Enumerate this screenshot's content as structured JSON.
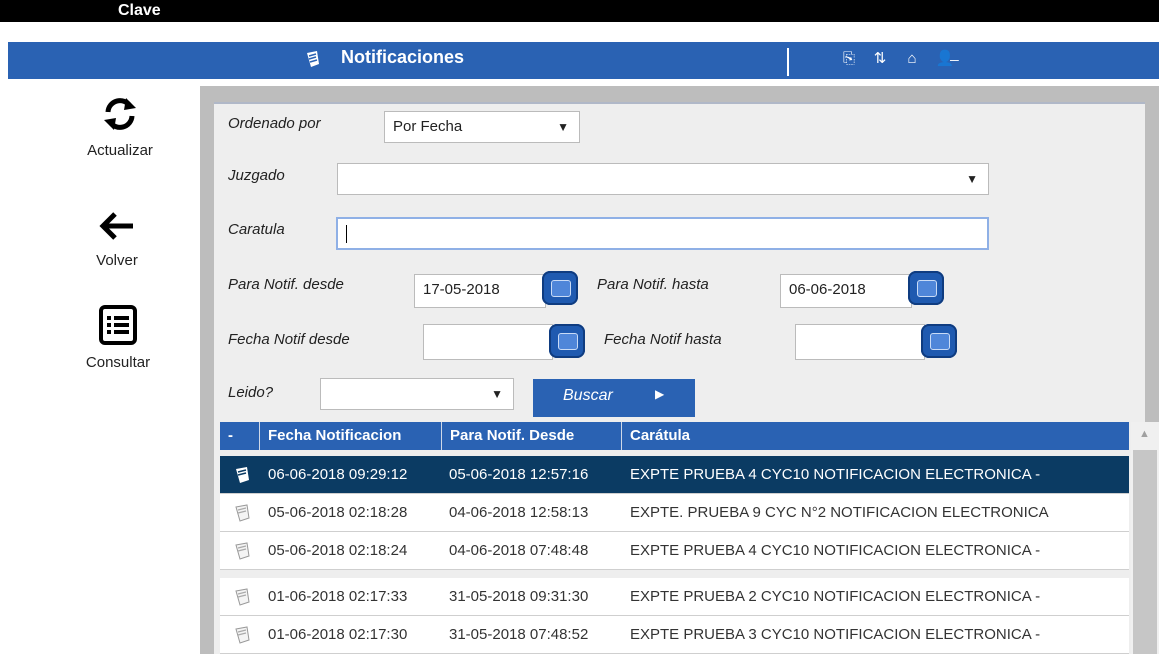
{
  "app": {
    "title": "Clave"
  },
  "header": {
    "title": "Notificaciones"
  },
  "nav": [
    {
      "label": "Actualizar",
      "icon": "refresh-icon"
    },
    {
      "label": "Volver",
      "icon": "arrow-left-icon"
    },
    {
      "label": "Consultar",
      "icon": "list-icon"
    }
  ],
  "form": {
    "ordenado_label": "Ordenado por",
    "ordenado_value": "Por Fecha",
    "juzgado_label": "Juzgado",
    "juzgado_value": "",
    "caratula_label": "Caratula",
    "caratula_value": "",
    "para_desde_label": "Para Notif. desde",
    "para_desde_value": "17-05-2018",
    "para_hasta_label": "Para Notif. hasta",
    "para_hasta_value": "06-06-2018",
    "fecha_desde_label": "Fecha Notif desde",
    "fecha_desde_value": "",
    "fecha_hasta_label": "Fecha Notif hasta",
    "fecha_hasta_value": "",
    "leido_label": "Leido?",
    "leido_value": "",
    "buscar_label": "Buscar"
  },
  "table": {
    "headers": [
      "-",
      "Fecha Notificacion",
      "Para Notif. Desde",
      "Carátula"
    ],
    "rows": [
      {
        "fecha": "06-06-2018 09:29:12",
        "desde": "05-06-2018 12:57:16",
        "caratula": "EXPTE PRUEBA 4 CYC10 NOTIFICACION ELECTRONICA -"
      },
      {
        "fecha": "05-06-2018 02:18:28",
        "desde": "04-06-2018 12:58:13",
        "caratula": "EXPTE. PRUEBA 9 CYC N°2 NOTIFICACION ELECTRONICA"
      },
      {
        "fecha": "05-06-2018 02:18:24",
        "desde": "04-06-2018 07:48:48",
        "caratula": "EXPTE PRUEBA 4 CYC10 NOTIFICACION ELECTRONICA -"
      },
      {
        "fecha": "01-06-2018 02:17:33",
        "desde": "31-05-2018 09:31:30",
        "caratula": "EXPTE PRUEBA 2 CYC10 NOTIFICACION ELECTRONICA -"
      },
      {
        "fecha": "01-06-2018 02:17:30",
        "desde": "31-05-2018 07:48:52",
        "caratula": "EXPTE PRUEBA 3 CYC10 NOTIFICACION ELECTRONICA -"
      }
    ]
  },
  "colors": {
    "accent": "#2a62b3",
    "selected_row": "#0b3b63"
  }
}
